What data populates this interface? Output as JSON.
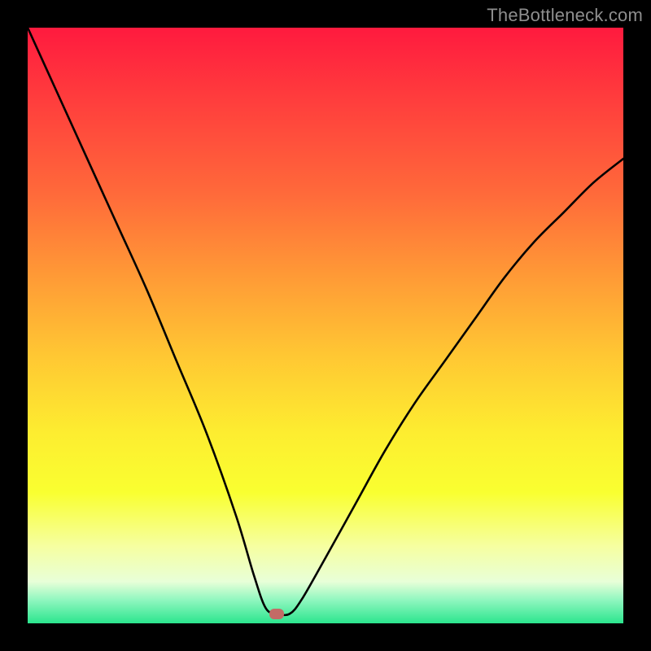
{
  "watermark": {
    "text": "TheBottleneck.com"
  },
  "marker": {
    "color": "#c36b66",
    "x_pct": 41.8,
    "y_pct": 98.3
  },
  "chart_data": {
    "type": "line",
    "title": "",
    "xlabel": "",
    "ylabel": "",
    "xlim": [
      0,
      100
    ],
    "ylim": [
      0,
      100
    ],
    "grid": false,
    "series": [
      {
        "name": "bottleneck-curve",
        "x": [
          0,
          5,
          10,
          15,
          20,
          25,
          30,
          35,
          38,
          40,
          42,
          44,
          46,
          50,
          55,
          60,
          65,
          70,
          75,
          80,
          85,
          90,
          95,
          100
        ],
        "y": [
          100,
          89,
          78,
          67,
          56,
          44,
          32,
          18,
          8,
          2.5,
          1.6,
          1.6,
          4,
          11,
          20,
          29,
          37,
          44,
          51,
          58,
          64,
          69,
          74,
          78
        ]
      }
    ],
    "marker_point": {
      "x": 42,
      "y": 1.6
    },
    "gradient_stops": [
      {
        "pct": 0,
        "color": "#ff1a3e"
      },
      {
        "pct": 12,
        "color": "#ff3d3d"
      },
      {
        "pct": 28,
        "color": "#ff6a3a"
      },
      {
        "pct": 42,
        "color": "#ff9b36"
      },
      {
        "pct": 55,
        "color": "#ffc733"
      },
      {
        "pct": 68,
        "color": "#fded30"
      },
      {
        "pct": 78,
        "color": "#f9ff30"
      },
      {
        "pct": 87,
        "color": "#f6ffa0"
      },
      {
        "pct": 93,
        "color": "#e8ffd8"
      },
      {
        "pct": 96,
        "color": "#92f7c0"
      },
      {
        "pct": 100,
        "color": "#2be58e"
      }
    ]
  }
}
